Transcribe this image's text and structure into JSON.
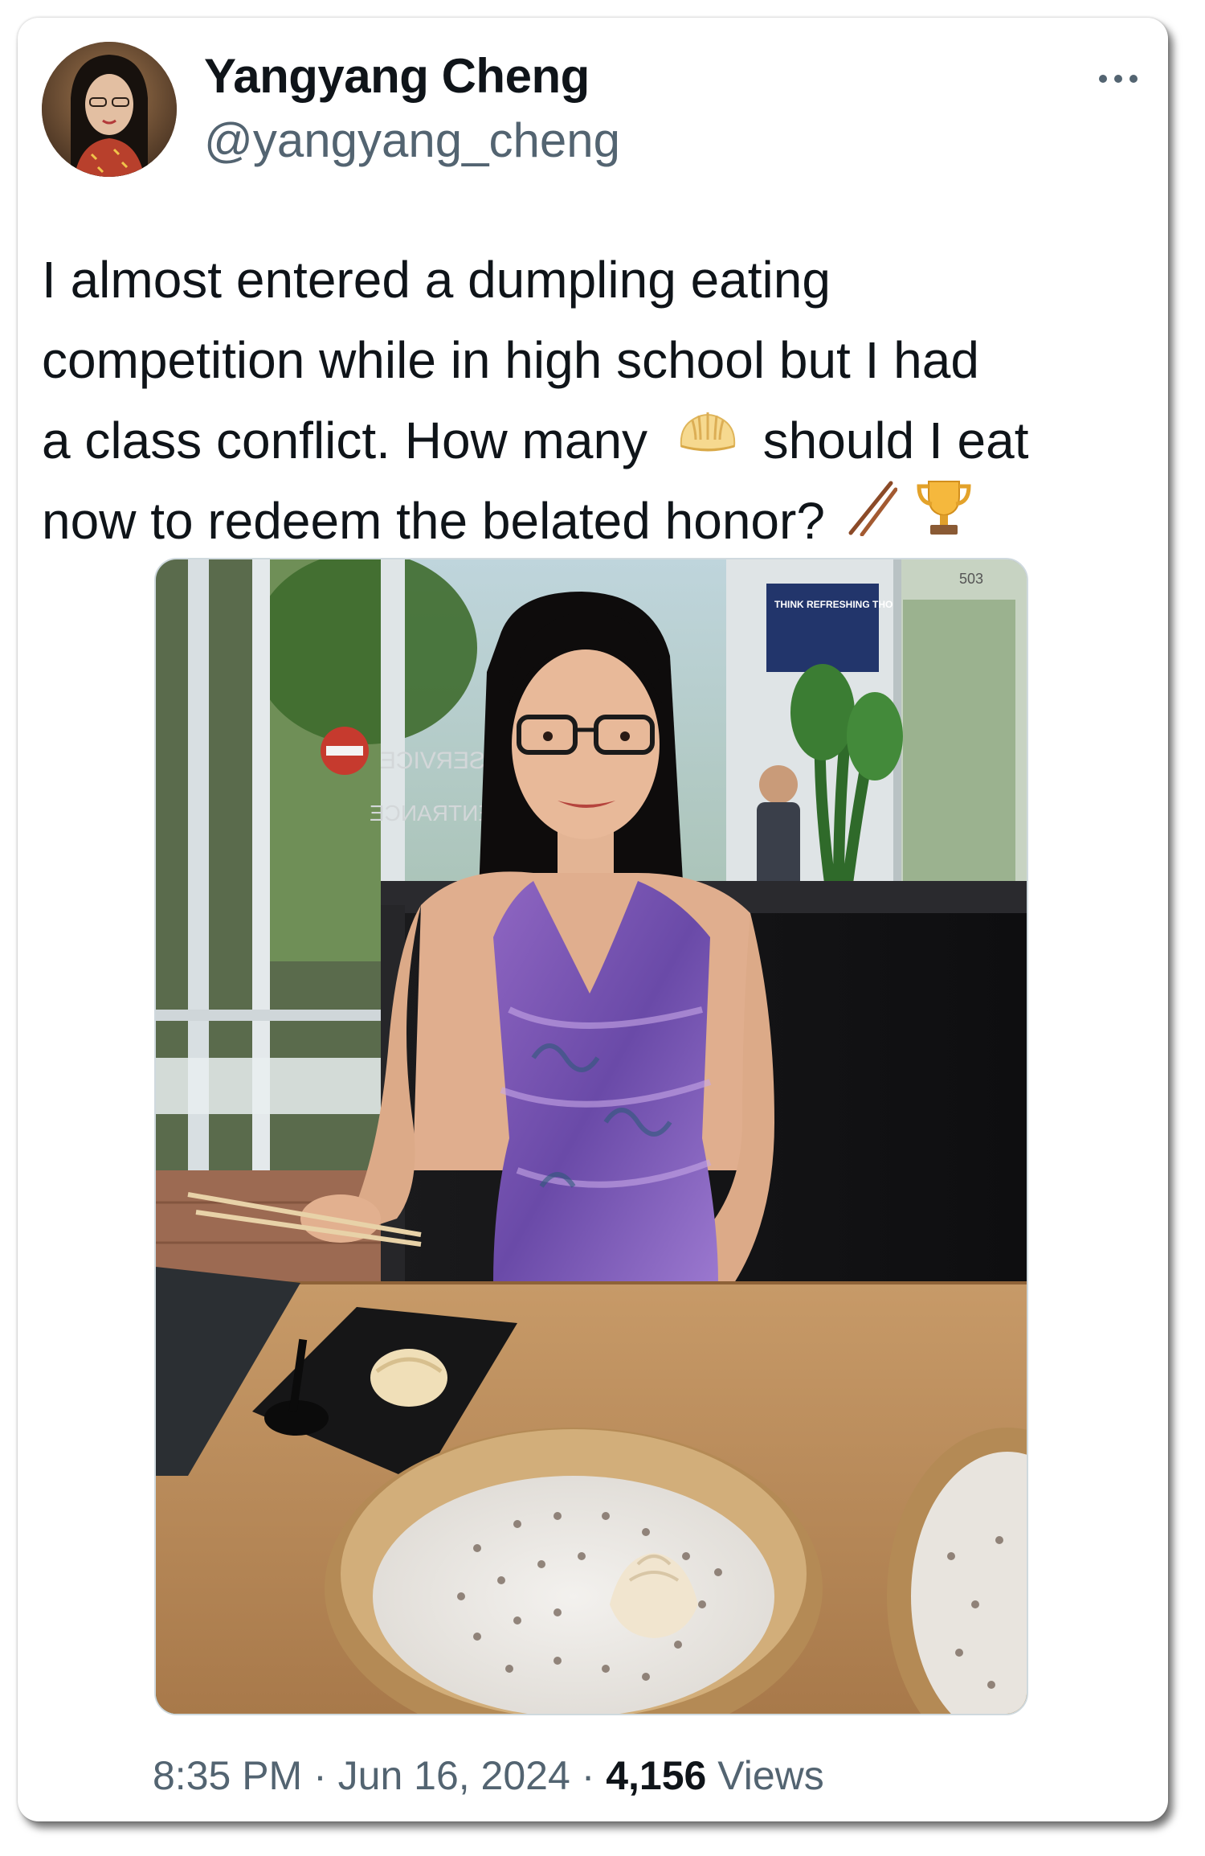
{
  "tweet": {
    "author": {
      "display_name": "Yangyang Cheng",
      "handle": "@yangyang_cheng"
    },
    "more_icon": "ellipsis-icon",
    "text_lines": [
      "I almost entered a dumpling eating",
      "competition while in high school but I had",
      "a class conflict. How many",
      "should I eat",
      "now to redeem the belated honor?"
    ],
    "emojis": {
      "dumpling": "dumpling-emoji",
      "chopsticks": "chopsticks-emoji",
      "trophy": "trophy-emoji"
    },
    "photo": {
      "sign_text": "THINK REFRESHING THOUGHTS",
      "door_text_1": "SERVICE",
      "door_text_2": "ENTRANCE",
      "door_number": "503"
    },
    "footer": {
      "time": "8:35 PM",
      "separator": " · ",
      "date": "Jun 16, 2024",
      "views_count": "4,156",
      "views_label": "Views"
    }
  }
}
